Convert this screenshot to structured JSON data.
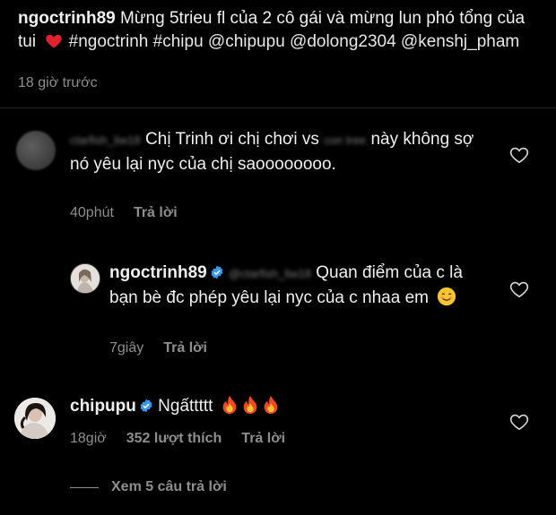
{
  "caption": {
    "username": "ngoctrinh89",
    "text_before": "Mừng 5trieu fl của 2 cô gái và mừng lun phó tổng của tui",
    "tags": "#ngoctrinh #chipu @chipupu @dolong2304 @kenshj_pham",
    "time": "18 giờ trước"
  },
  "comment1": {
    "username": "ctarfish_liw18",
    "text_a": "Chị Trinh ơi chị chơi vs",
    "mention": "con tree",
    "text_b": "này không sợ nó yêu lại nyc của chị saoooooooo.",
    "time": "40phút",
    "reply": "Trả lời"
  },
  "reply1": {
    "username": "ngoctrinh89",
    "mention": "@ctarfish_liw18",
    "text": "Quan điểm của c là bạn bè đc phép yêu lại nyc của c nhaa em",
    "time": "7giây",
    "reply": "Trả lời"
  },
  "comment2": {
    "username": "chipupu",
    "text": "Ngấttttt",
    "time": "18giờ",
    "likes": "352 lượt thích",
    "reply": "Trả lời"
  },
  "view_replies": "Xem 5 câu trả lời",
  "icons": {
    "like": "heart-outline-icon",
    "verified": "verified-badge-icon",
    "fire": "fire-emoji-icon",
    "smile": "smiling-face-emoji-icon"
  },
  "colors": {
    "background": "#000000",
    "text": "#f0f0f0",
    "muted": "#8e8e8e",
    "verified": "#3897f0"
  }
}
